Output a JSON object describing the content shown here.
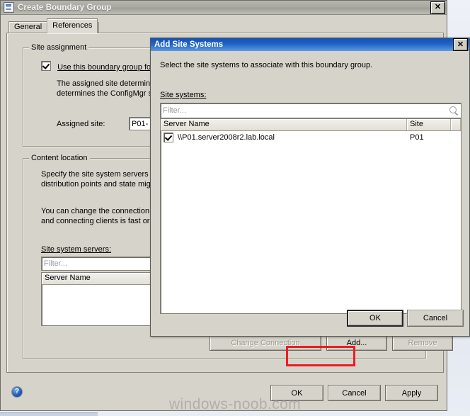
{
  "desktop": {
    "watermark": "windows-noob.com"
  },
  "main_window": {
    "title": "Create Boundary Group",
    "icon": "window-icon",
    "close_label": "✕",
    "tabs": [
      {
        "label": "General",
        "active": false
      },
      {
        "label": "References",
        "active": true
      }
    ],
    "site_assignment": {
      "group_title": "Site assignment",
      "checkbox_label": "Use this boundary group for site",
      "checkbox_checked": true,
      "description_line1": "The assigned site determines th",
      "description_line2": "determines the ConfigMgr site th",
      "assigned_site_label": "Assigned site:",
      "assigned_site_value": "P01-"
    },
    "content_location": {
      "group_title": "Content location",
      "description_line1": "Specify the site system servers that",
      "description_line2": "distribution points and state migratio",
      "description_line3": "You can change the connection to",
      "description_line4": "and connecting clients is fast or slo",
      "servers_label": "Site system servers:",
      "filter_placeholder": "Filter...",
      "columns": [
        "Server Name"
      ],
      "rows": []
    },
    "buttons": {
      "change_connection": "Change Connection",
      "add": "Add...",
      "remove": "Remove",
      "ok": "OK",
      "cancel": "Cancel",
      "apply": "Apply"
    },
    "help_icon_label": "?"
  },
  "modal": {
    "title": "Add Site Systems",
    "close_label": "✕",
    "instruction": "Select the site systems to associate with this boundary group.",
    "site_systems_label": "Site systems:",
    "filter_placeholder": "Filter...",
    "search_icon": "search-icon",
    "columns": [
      "Server Name",
      "Site"
    ],
    "rows": [
      {
        "checked": true,
        "server_name": "\\\\P01.server2008r2.lab.local",
        "site": "P01"
      }
    ],
    "buttons": {
      "ok": "OK",
      "cancel": "Cancel"
    }
  },
  "highlight": {
    "target": "Add...",
    "color": "#ee1b24"
  },
  "colors": {
    "dialog_face": "#d6d3ca",
    "modal_titlebar_blue": "#1f5fc0",
    "main_titlebar_gray": "#a9a8a0",
    "highlight_red": "#ee1b24",
    "disabled_text": "#9d9a92"
  }
}
